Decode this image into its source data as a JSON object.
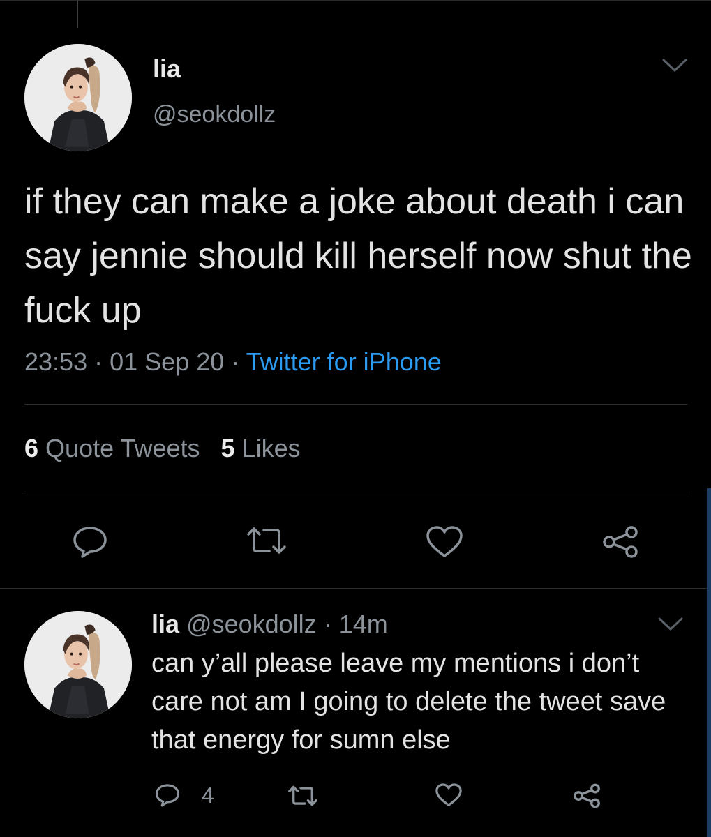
{
  "tweet": {
    "author_name": "lia",
    "author_handle": "@seokdollz",
    "text": "if they can make a joke about death i can say jennie should kill herself now shut the fuck up",
    "time": "23:53",
    "date": "01 Sep 20",
    "separator": "·",
    "source": "Twitter for iPhone",
    "quote_count": "6",
    "quote_label": "Quote Tweets",
    "like_count": "5",
    "like_label": "Likes"
  },
  "reply": {
    "author_name": "lia",
    "author_handle": "@seokdollz",
    "time_ago": "14m",
    "separator": "·",
    "text": "can y’all please leave my mentions i don’t care not am I going to delete the tweet save that energy for sumn else",
    "reply_count": "4"
  },
  "icons": {
    "reply": "reply-icon",
    "retweet": "retweet-icon",
    "like": "heart-icon",
    "share": "share-icon",
    "menu": "chevron-down-icon"
  },
  "colors": {
    "background": "#000000",
    "text": "#e3e3e3",
    "muted": "#8b9299",
    "link": "#2a9bf0"
  }
}
